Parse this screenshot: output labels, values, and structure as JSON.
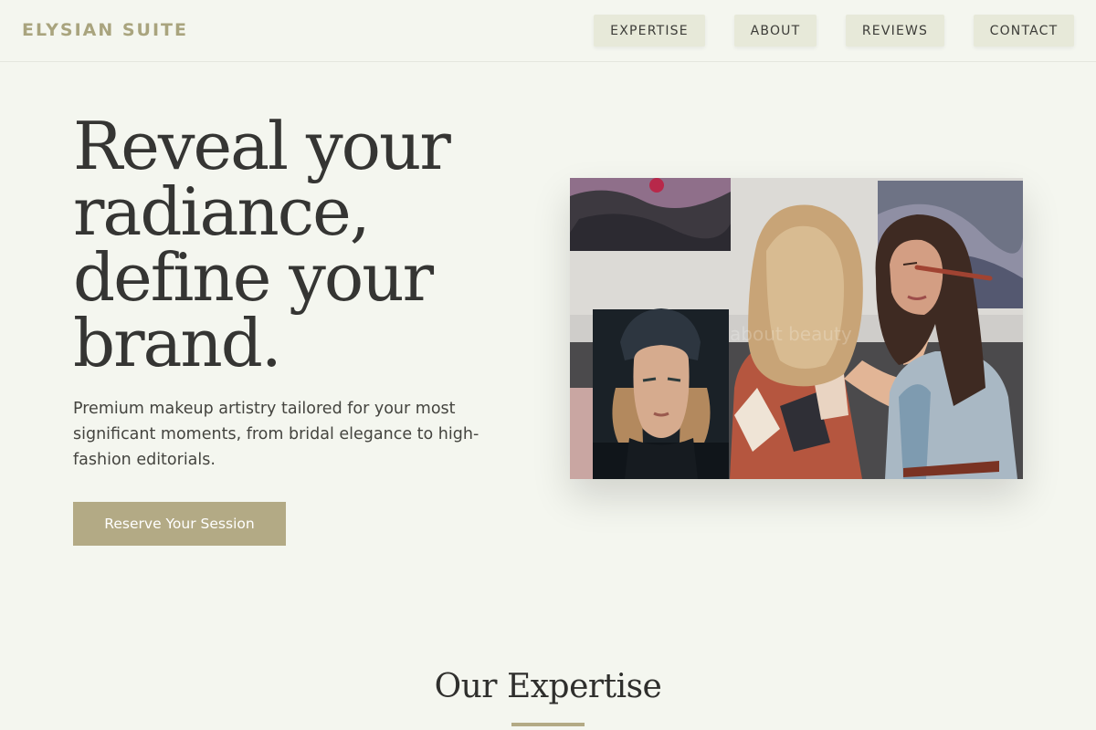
{
  "header": {
    "brand": "ELYSIAN SUITE",
    "nav": [
      {
        "label": "EXPERTISE"
      },
      {
        "label": "ABOUT"
      },
      {
        "label": "REVIEWS"
      },
      {
        "label": "CONTACT"
      }
    ]
  },
  "hero": {
    "title_lines": [
      "Reveal your",
      "radiance,",
      "define your",
      "brand."
    ],
    "description": "Premium makeup artistry tailored for your most significant moments, from bridal elegance to high-fashion editorials.",
    "cta_label": "Reserve Your Session",
    "image_watermark": "about beauty"
  },
  "expertise": {
    "title": "Our Expertise"
  },
  "colors": {
    "background": "#f4f6ef",
    "accent": "#b3aa85",
    "nav_button_bg": "#e7e9d9",
    "brand_text": "#a9a47e",
    "heading_text": "#353533"
  }
}
